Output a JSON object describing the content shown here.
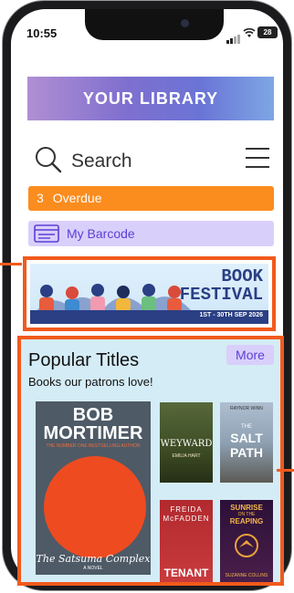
{
  "status_bar": {
    "time": "10:55",
    "battery": "28"
  },
  "banner": {
    "title": "YOUR LIBRARY"
  },
  "search": {
    "label": "Search"
  },
  "overdue": {
    "count": "3",
    "label": "Overdue"
  },
  "barcode": {
    "label": "My Barcode"
  },
  "book_festival": {
    "line1": "BOOK",
    "line2": "FESTIVAL",
    "dates": "1ST - 30TH SEP 2026"
  },
  "popular": {
    "title": "Popular Titles",
    "subtitle": "Books our patrons love!",
    "more_label": "More",
    "books": [
      {
        "author": "BOB MORTIMER",
        "author_line1": "BOB",
        "author_line2": "MORTIMER",
        "tagline": "THE NUMBER ONE BESTSELLING AUTHOR",
        "title": "The Satsuma Complex",
        "sub": "A NOVEL"
      },
      {
        "title": "WEYWARD",
        "author": "EMILIA HART"
      },
      {
        "author": "RAYNOR WINN",
        "title_line1": "THE",
        "title_line2": "SALT",
        "title_line3": "PATH"
      },
      {
        "author_line1": "FREIDA",
        "author_line2": "McFADDEN",
        "title": "TENANT"
      },
      {
        "title_line1": "SUNRISE",
        "title_line2": "ON THE",
        "title_line3": "REAPING",
        "author": "SUZANNE COLLINS"
      }
    ]
  },
  "colors": {
    "overdue_bg": "#fb8c1e",
    "barcode_bg": "#d9cffb",
    "accent_purple": "#5b3fd6",
    "highlight_orange": "#f15a1c",
    "popular_bg": "#d4ecf5"
  }
}
